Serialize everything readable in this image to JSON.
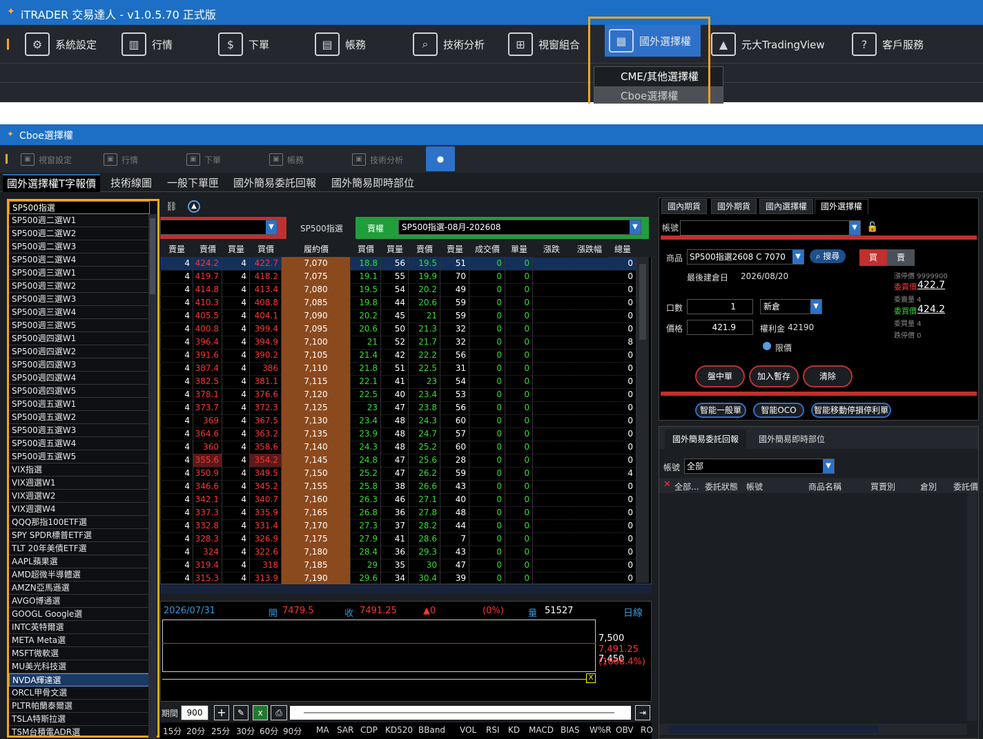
{
  "app": {
    "title": "iTRADER 交易達人 - v1.0.5.70 正式版"
  },
  "menu": {
    "items": [
      {
        "label": "系統設定",
        "icon": "gear-icon"
      },
      {
        "label": "行情",
        "icon": "chart-icon"
      },
      {
        "label": "下單",
        "icon": "order-icon"
      },
      {
        "label": "帳務",
        "icon": "account-icon"
      },
      {
        "label": "技術分析",
        "icon": "analysis-icon"
      },
      {
        "label": "視窗組合",
        "icon": "window-icon"
      },
      {
        "label": "國外選擇權",
        "icon": "foreign-option-icon"
      },
      {
        "label": "元大TradingView",
        "icon": "tradingview-icon"
      },
      {
        "label": "客戶服務",
        "icon": "service-icon"
      }
    ],
    "dropdown": [
      "CME/其他選擇權",
      "Cboe選擇權"
    ]
  },
  "window": {
    "title": "Cboe選擇權",
    "tools": [
      "視窗設定",
      "行情",
      "下單",
      "帳務",
      "技術分析"
    ],
    "tabs": [
      "國外選擇權T字報價",
      "技術線圖",
      "一般下單匣",
      "國外簡易委託回報",
      "國外簡易即時部位"
    ]
  },
  "list": [
    "SP500指選",
    "SP500週二選W1",
    "SP500週二選W2",
    "SP500週二選W3",
    "SP500週二選W4",
    "SP500週三選W1",
    "SP500週三選W2",
    "SP500週三選W3",
    "SP500週三選W4",
    "SP500週三選W5",
    "SP500週四選W1",
    "SP500週四選W2",
    "SP500週四選W3",
    "SP500週四選W4",
    "SP500週四選W5",
    "SP500週五選W1",
    "SP500週五選W2",
    "SP500週五選W3",
    "SP500週五選W4",
    "SP500週五選W5",
    "VIX指選",
    "VIX週選W1",
    "VIX週選W2",
    "VIX週選W4",
    "QQQ那指100ETF選",
    "SPY SPDR標普ETF選",
    "TLT 20年美債ETF選",
    "AAPL蘋果選",
    "AMD超微半導體選",
    "AMZN亞馬遜選",
    "AVGO博通選",
    "GOOGL Google選",
    "INTC英特爾選",
    "META Meta選",
    "MSFT微軟選",
    "MU美光科技選",
    "NVDA輝達選",
    "ORCL甲骨文選",
    "PLTR帕蘭泰爾選",
    "TSLA特斯拉選",
    "TSM台積電ADR選"
  ],
  "quote": {
    "underlying": "SP500指選",
    "put_label": "賣權",
    "contract": "SP500指選-08月-202608",
    "headers": [
      "賣量",
      "賣價",
      "買量",
      "買價",
      "履約價",
      "買價",
      "買量",
      "賣價",
      "賣量",
      "成交價",
      "單量",
      "漲跌",
      "漲跌幅",
      "總量"
    ],
    "rows": [
      [
        "4",
        "424.2",
        "4",
        "422.7",
        "7,070",
        "18.8",
        "56",
        "19.5",
        "51",
        "0",
        "0",
        "",
        "",
        "0"
      ],
      [
        "4",
        "419.7",
        "4",
        "418.2",
        "7,075",
        "19.1",
        "55",
        "19.9",
        "70",
        "0",
        "0",
        "",
        "",
        "0"
      ],
      [
        "4",
        "414.8",
        "4",
        "413.4",
        "7,080",
        "19.5",
        "54",
        "20.2",
        "49",
        "0",
        "0",
        "",
        "",
        "0"
      ],
      [
        "4",
        "410.3",
        "4",
        "408.8",
        "7,085",
        "19.8",
        "44",
        "20.6",
        "59",
        "0",
        "0",
        "",
        "",
        "0"
      ],
      [
        "4",
        "405.5",
        "4",
        "404.1",
        "7,090",
        "20.2",
        "45",
        "21",
        "59",
        "0",
        "0",
        "",
        "",
        "0"
      ],
      [
        "4",
        "400.8",
        "4",
        "399.4",
        "7,095",
        "20.6",
        "50",
        "21.3",
        "32",
        "0",
        "0",
        "",
        "",
        "0"
      ],
      [
        "4",
        "396.4",
        "4",
        "394.9",
        "7,100",
        "21",
        "52",
        "21.7",
        "32",
        "0",
        "0",
        "",
        "",
        "8"
      ],
      [
        "4",
        "391.6",
        "4",
        "390.2",
        "7,105",
        "21.4",
        "42",
        "22.2",
        "56",
        "0",
        "0",
        "",
        "",
        "0"
      ],
      [
        "4",
        "387.4",
        "4",
        "386",
        "7,110",
        "21.8",
        "51",
        "22.5",
        "31",
        "0",
        "0",
        "",
        "",
        "0"
      ],
      [
        "4",
        "382.5",
        "4",
        "381.1",
        "7,115",
        "22.1",
        "41",
        "23",
        "54",
        "0",
        "0",
        "",
        "",
        "0"
      ],
      [
        "4",
        "378.1",
        "4",
        "376.6",
        "7,120",
        "22.5",
        "40",
        "23.4",
        "53",
        "0",
        "0",
        "",
        "",
        "0"
      ],
      [
        "4",
        "373.7",
        "4",
        "372.3",
        "7,125",
        "23",
        "47",
        "23.8",
        "56",
        "0",
        "0",
        "",
        "",
        "0"
      ],
      [
        "4",
        "369",
        "4",
        "367.5",
        "7,130",
        "23.4",
        "48",
        "24.3",
        "60",
        "0",
        "0",
        "",
        "",
        "0"
      ],
      [
        "4",
        "364.6",
        "4",
        "363.2",
        "7,135",
        "23.9",
        "48",
        "24.7",
        "57",
        "0",
        "0",
        "",
        "",
        "0"
      ],
      [
        "4",
        "360",
        "4",
        "358.6",
        "7,140",
        "24.3",
        "48",
        "25.2",
        "60",
        "0",
        "0",
        "",
        "",
        "0"
      ],
      [
        "4",
        "355.6",
        "4",
        "354.2",
        "7,145",
        "24.8",
        "47",
        "25.6",
        "28",
        "0",
        "0",
        "",
        "",
        "0"
      ],
      [
        "4",
        "350.9",
        "4",
        "349.5",
        "7,150",
        "25.2",
        "47",
        "26.2",
        "59",
        "0",
        "0",
        "",
        "",
        "4"
      ],
      [
        "4",
        "346.6",
        "4",
        "345.2",
        "7,155",
        "25.8",
        "38",
        "26.6",
        "43",
        "0",
        "0",
        "",
        "",
        "0"
      ],
      [
        "4",
        "342.1",
        "4",
        "340.7",
        "7,160",
        "26.3",
        "46",
        "27.1",
        "40",
        "0",
        "0",
        "",
        "",
        "0"
      ],
      [
        "4",
        "337.3",
        "4",
        "335.9",
        "7,165",
        "26.8",
        "36",
        "27.8",
        "48",
        "0",
        "0",
        "",
        "",
        "0"
      ],
      [
        "4",
        "332.8",
        "4",
        "331.4",
        "7,170",
        "27.3",
        "37",
        "28.2",
        "44",
        "0",
        "0",
        "",
        "",
        "0"
      ],
      [
        "4",
        "328.3",
        "4",
        "326.9",
        "7,175",
        "27.9",
        "41",
        "28.6",
        "7",
        "0",
        "0",
        "",
        "",
        "0"
      ],
      [
        "4",
        "324",
        "4",
        "322.6",
        "7,180",
        "28.4",
        "36",
        "29.3",
        "43",
        "0",
        "0",
        "",
        "",
        "0"
      ],
      [
        "4",
        "319.4",
        "4",
        "318",
        "7,185",
        "29",
        "35",
        "30",
        "47",
        "0",
        "0",
        "",
        "",
        "0"
      ],
      [
        "4",
        "315.3",
        "4",
        "313.9",
        "7,190",
        "29.6",
        "34",
        "30.4",
        "39",
        "0",
        "0",
        "",
        "",
        "0"
      ]
    ]
  },
  "chart": {
    "date": "2026/07/31",
    "open_label": "開",
    "open": "7479.5",
    "close_label": "收",
    "close": "7491.25",
    "change": "▲0",
    "pct": "(0%)",
    "vol_label": "量",
    "vol": "51527",
    "period": "日線",
    "y1": "7,500",
    "y2": "7,491.25",
    "y3": "7,450",
    "y4": "(1668.4%)",
    "x_mark": "X",
    "period_label": "期間",
    "period_val": "900"
  },
  "indicators": [
    "15分",
    "20分",
    "25分",
    "30分",
    "60分",
    "90分",
    "MA",
    "SAR",
    "CDP",
    "KD520",
    "BBand",
    "VOL",
    "RSI",
    "KD",
    "MACD",
    "BIAS",
    "W%R",
    "OBV",
    "RO"
  ],
  "order": {
    "tabs": [
      "國內期貨",
      "國外期貨",
      "國內選擇權",
      "國外選擇權"
    ],
    "account_label": "帳號",
    "product_label": "商品",
    "product": "SP500指選2608 C 7070",
    "search": "搜尋",
    "buy": "買",
    "sell": "賣",
    "last_date_label": "最後建倉日",
    "last_date": "2026/08/20",
    "qty_label": "口數",
    "qty": "1",
    "oc": "新倉",
    "price_label": "價格",
    "price": "421.9",
    "premium_label": "權利金",
    "premium": "42190",
    "limit": "限價",
    "limit_up": "漲停價 9999900",
    "ask_label": "委賣價",
    "ask": "422.7",
    "ask_qty": "委賣量 4",
    "bid_label": "委買價",
    "bid": "424.2",
    "bid_qty": "委買量 4",
    "limit_down": "跌停價 0",
    "btns": [
      "盤中單",
      "加入暫存",
      "清除"
    ],
    "smart": [
      "智能一般單",
      "智能OCO",
      "智能移動停損停利單"
    ]
  },
  "report": {
    "tabs": [
      "國外簡易委託回報",
      "國外簡易即時部位"
    ],
    "account_label": "帳號",
    "account": "全部",
    "cols": [
      "全部...",
      "委託狀態",
      "帳號",
      "商品名稱",
      "買賣別",
      "倉別",
      "委託價"
    ]
  }
}
